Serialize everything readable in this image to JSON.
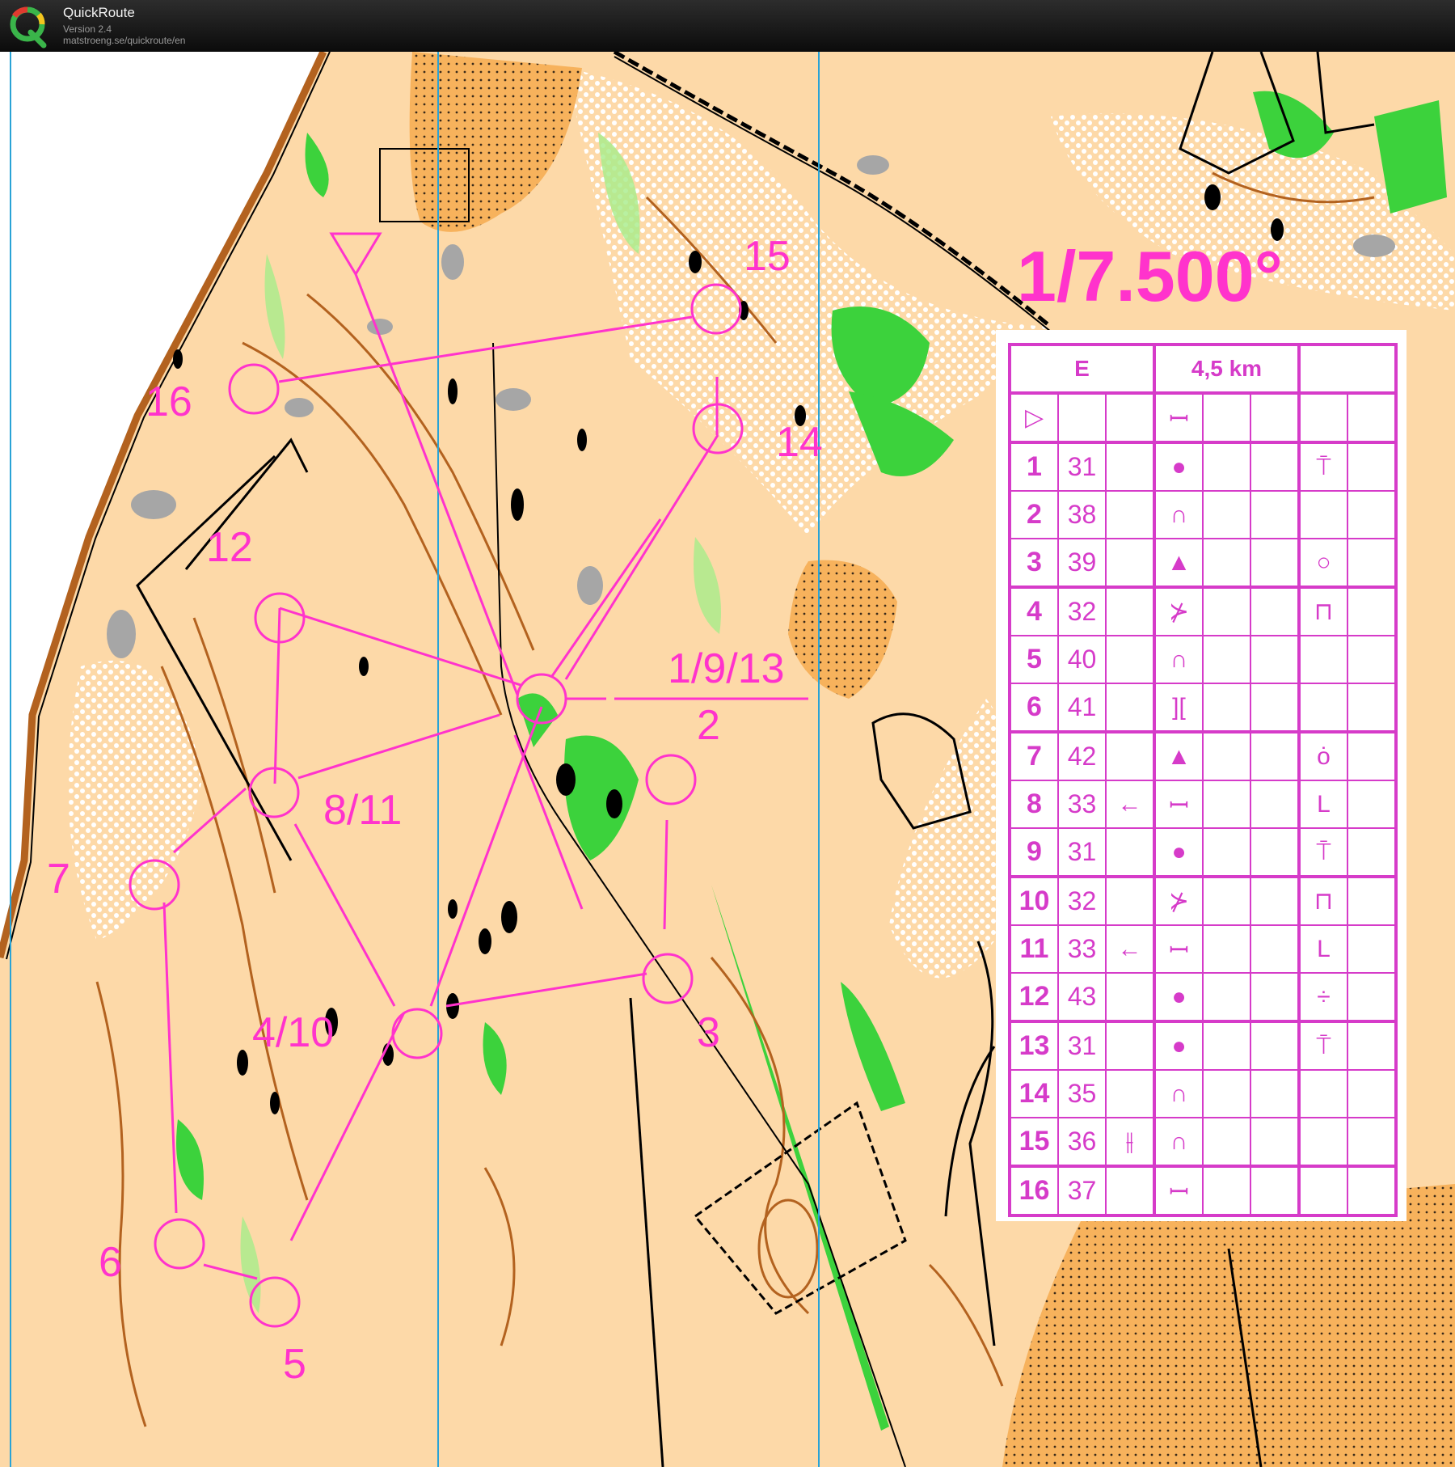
{
  "app": {
    "title": "QuickRoute",
    "version": "Version 2.4",
    "url": "matstroeng.se/quickroute/en",
    "logo_letter": "Q"
  },
  "map": {
    "scale_text": "1/7.500°",
    "colors": {
      "open_land": "#fdd9a8",
      "rough_open": "#f7b25c",
      "forest_green": "#3cd23c",
      "light_green": "#a6ec8a",
      "contour": "#b3621f",
      "course": "#ff33cc",
      "rock": "#a6a6a6",
      "north_line": "#29a3d6"
    },
    "control_labels": [
      {
        "id": "16",
        "text": "16"
      },
      {
        "id": "15",
        "text": "15"
      },
      {
        "id": "14",
        "text": "14"
      },
      {
        "id": "12",
        "text": "12"
      },
      {
        "id": "1-9-13",
        "text": "1/9/13"
      },
      {
        "id": "2",
        "text": "2"
      },
      {
        "id": "8-11",
        "text": "8/11"
      },
      {
        "id": "7",
        "text": "7"
      },
      {
        "id": "3",
        "text": "3"
      },
      {
        "id": "4-10",
        "text": "4/10"
      },
      {
        "id": "6",
        "text": "6"
      },
      {
        "id": "5",
        "text": "5"
      }
    ]
  },
  "description": {
    "class": "E",
    "length": "4,5 km",
    "start_symbol": "▷",
    "start_feature": "ꟷ",
    "rows": [
      {
        "n": "1",
        "code": "31",
        "dir": "",
        "feature": "●",
        "loc": "⍑"
      },
      {
        "n": "2",
        "code": "38",
        "dir": "",
        "feature": "∩",
        "loc": ""
      },
      {
        "n": "3",
        "code": "39",
        "dir": "",
        "feature": "▲",
        "loc": "○"
      },
      {
        "n": "4",
        "code": "32",
        "dir": "",
        "feature": "⊁",
        "loc": "⊓"
      },
      {
        "n": "5",
        "code": "40",
        "dir": "",
        "feature": "∩",
        "loc": ""
      },
      {
        "n": "6",
        "code": "41",
        "dir": "",
        "feature": "][",
        "loc": ""
      },
      {
        "n": "7",
        "code": "42",
        "dir": "",
        "feature": "▲",
        "loc": "ȯ"
      },
      {
        "n": "8",
        "code": "33",
        "dir": "←",
        "feature": "ꟷ",
        "loc": "L"
      },
      {
        "n": "9",
        "code": "31",
        "dir": "",
        "feature": "●",
        "loc": "⍑"
      },
      {
        "n": "10",
        "code": "32",
        "dir": "",
        "feature": "⊁",
        "loc": "⊓"
      },
      {
        "n": "11",
        "code": "33",
        "dir": "←",
        "feature": "ꟷ",
        "loc": "L"
      },
      {
        "n": "12",
        "code": "43",
        "dir": "",
        "feature": "●",
        "loc": "÷"
      },
      {
        "n": "13",
        "code": "31",
        "dir": "",
        "feature": "●",
        "loc": "⍑"
      },
      {
        "n": "14",
        "code": "35",
        "dir": "",
        "feature": "∩",
        "loc": ""
      },
      {
        "n": "15",
        "code": "36",
        "dir": "⫲",
        "feature": "∩",
        "loc": ""
      },
      {
        "n": "16",
        "code": "37",
        "dir": "",
        "feature": "ꟷ",
        "loc": ""
      }
    ]
  }
}
